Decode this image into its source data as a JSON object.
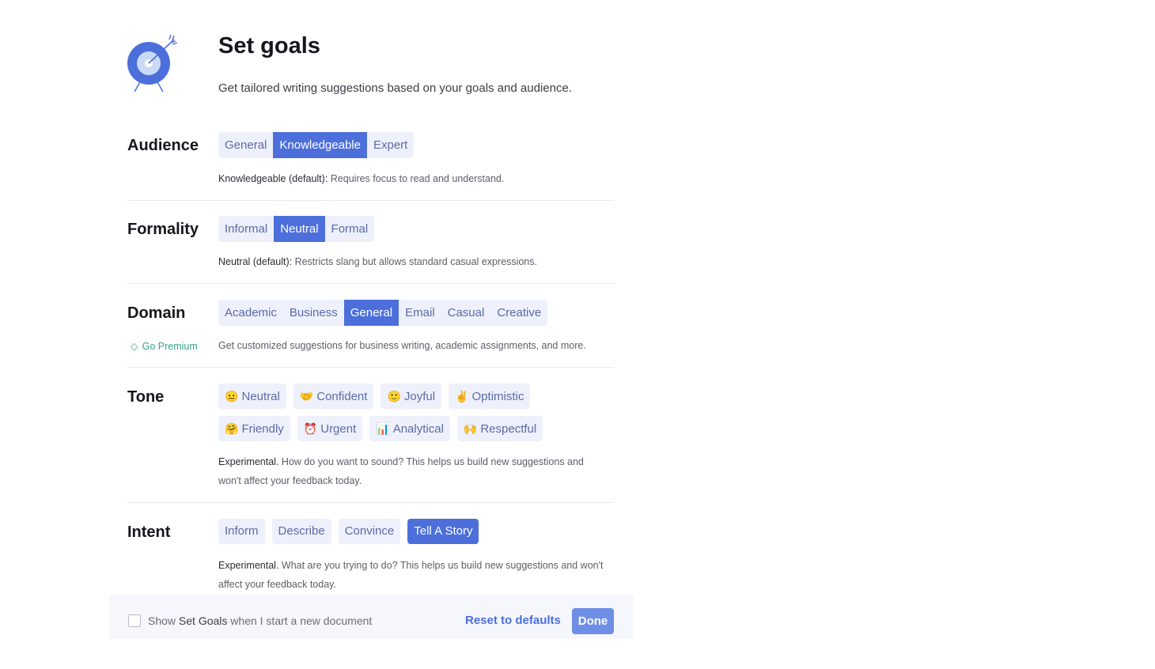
{
  "header": {
    "title": "Set goals",
    "subtitle": "Get tailored writing suggestions based on your goals and audience."
  },
  "colors": {
    "accent": "#4c6fdb",
    "chip_bg": "#eef1fb",
    "premium": "#3aa28a"
  },
  "audience": {
    "label": "Audience",
    "options": [
      "General",
      "Knowledgeable",
      "Expert"
    ],
    "selected": "Knowledgeable",
    "desc_bold": "Knowledgeable (default):",
    "desc": " Requires focus to read and understand."
  },
  "formality": {
    "label": "Formality",
    "options": [
      "Informal",
      "Neutral",
      "Formal"
    ],
    "selected": "Neutral",
    "desc_bold": "Neutral (default):",
    "desc": " Restricts slang but allows standard casual expressions."
  },
  "domain": {
    "label": "Domain",
    "premium": "Go Premium",
    "options": [
      "Academic",
      "Business",
      "General",
      "Email",
      "Casual",
      "Creative"
    ],
    "selected": "General",
    "desc": "Get customized suggestions for business writing, academic assignments, and more."
  },
  "tone": {
    "label": "Tone",
    "options": [
      {
        "emoji": "😐",
        "label": "Neutral"
      },
      {
        "emoji": "🤝",
        "label": "Confident"
      },
      {
        "emoji": "🙂",
        "label": "Joyful"
      },
      {
        "emoji": "✌️",
        "label": "Optimistic"
      },
      {
        "emoji": "🤗",
        "label": "Friendly"
      },
      {
        "emoji": "⏰",
        "label": "Urgent"
      },
      {
        "emoji": "📊",
        "label": "Analytical"
      },
      {
        "emoji": "🙌",
        "label": "Respectful"
      }
    ],
    "desc_bold": "Experimental.",
    "desc": " How do you want to sound? This helps us build new suggestions and won't affect your feedback today."
  },
  "intent": {
    "label": "Intent",
    "options": [
      "Inform",
      "Describe",
      "Convince",
      "Tell A Story"
    ],
    "selected": "Tell A Story",
    "desc_bold": "Experimental.",
    "desc": " What are you trying to do? This helps us build new suggestions and won't affect your feedback today."
  },
  "footer": {
    "checkbox_pre": "Show ",
    "checkbox_bold": "Set Goals",
    "checkbox_post": " when I start a new document",
    "checked": false,
    "reset": "Reset to defaults",
    "done": "Done"
  }
}
